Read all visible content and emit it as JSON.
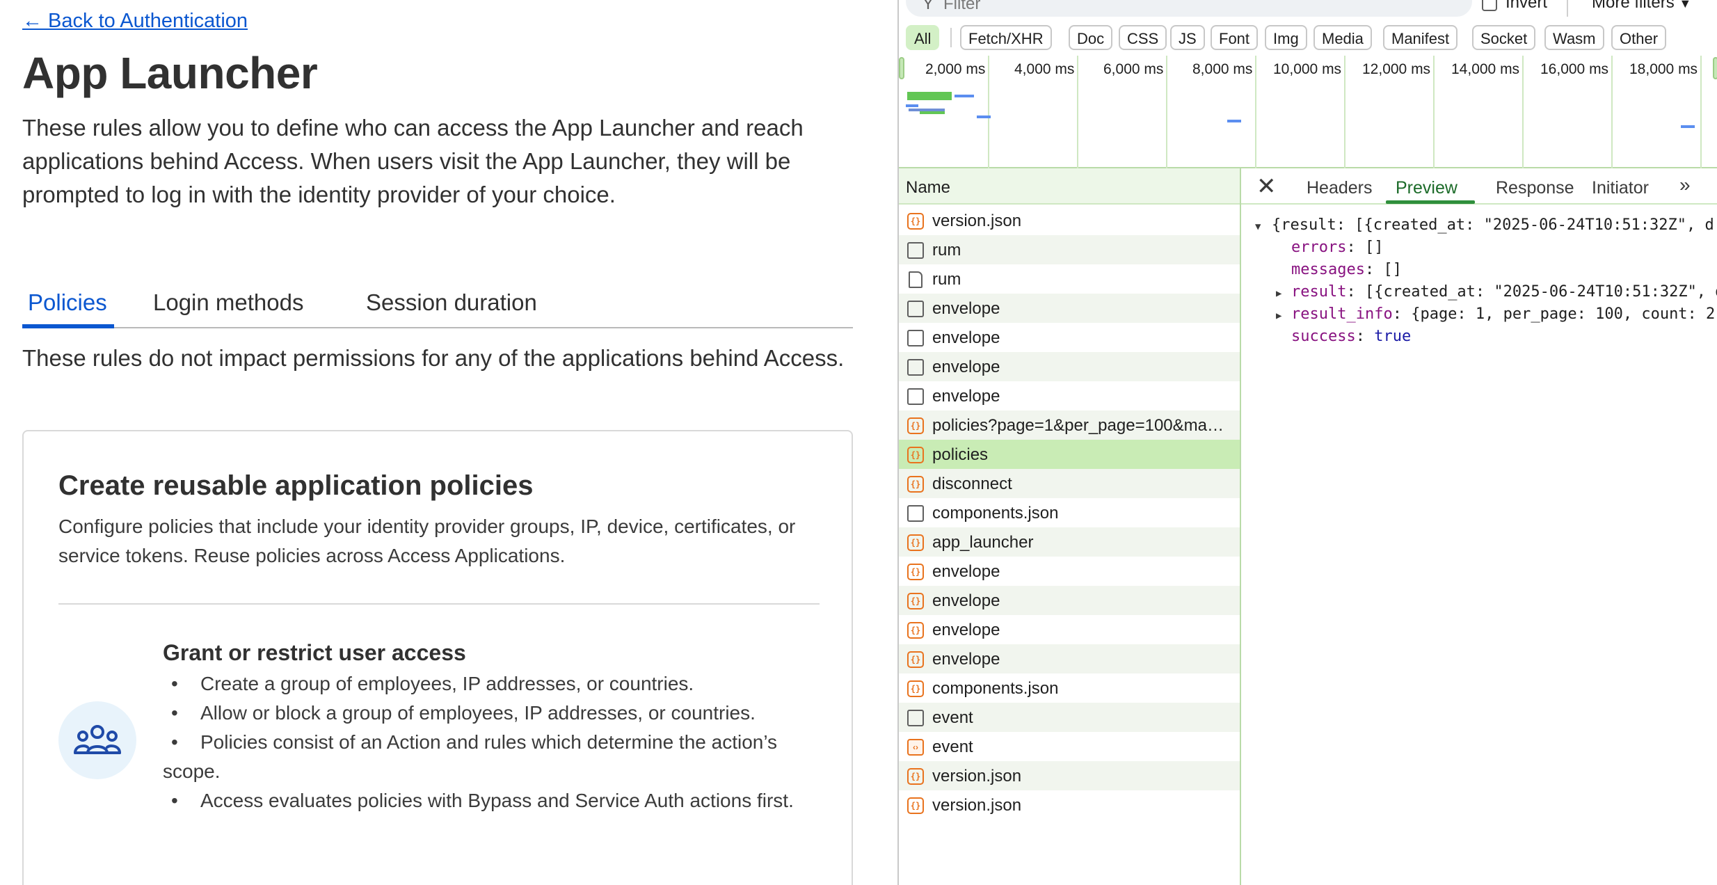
{
  "app": {
    "back_link": "← Back to Authentication",
    "title": "App Launcher",
    "description": "These rules allow you to define who can access the App Launcher and reach applications behind Access. When users visit the App Launcher, they will be prompted to log in with the identity provider of your choice.",
    "tabs": [
      {
        "label": "Policies",
        "active": true
      },
      {
        "label": "Login methods",
        "active": false
      },
      {
        "label": "Session duration",
        "active": false
      }
    ],
    "tab_note": "These rules do not impact permissions for any of the applications behind Access.",
    "card": {
      "title": "Create reusable application policies",
      "description": "Configure policies that include your identity provider groups, IP, device, certificates, or service tokens. Reuse policies across Access Applications.",
      "icon": "users-group-icon",
      "section_title": "Grant or restrict user access",
      "bullets": [
        "Create a group of employees, IP addresses, or countries.",
        "Allow or block a group of employees, IP addresses, or countries.",
        "Policies consist of an Action and rules which determine the action’s scope.",
        "Access evaluates policies with Bypass and Service Auth actions first."
      ]
    }
  },
  "devtools": {
    "filter_placeholder": "Filter",
    "invert_label": "Invert",
    "more_filters": "More filters",
    "type_filters": [
      "All",
      "Fetch/XHR",
      "Doc",
      "CSS",
      "JS",
      "Font",
      "Img",
      "Media",
      "Manifest",
      "Socket",
      "Wasm",
      "Other"
    ],
    "active_type_filter": "All",
    "timeline_ticks": [
      "2,000 ms",
      "4,000 ms",
      "6,000 ms",
      "8,000 ms",
      "10,000 ms",
      "12,000 ms",
      "14,000 ms",
      "16,000 ms",
      "18,000 ms"
    ],
    "name_header": "Name",
    "requests": [
      {
        "name": "version.json",
        "icon": "json-icon"
      },
      {
        "name": "rum",
        "icon": "checkbox-icon"
      },
      {
        "name": "rum",
        "icon": "document-icon"
      },
      {
        "name": "envelope",
        "icon": "checkbox-icon"
      },
      {
        "name": "envelope",
        "icon": "checkbox-icon"
      },
      {
        "name": "envelope",
        "icon": "checkbox-icon"
      },
      {
        "name": "envelope",
        "icon": "checkbox-icon"
      },
      {
        "name": "policies?page=1&per_page=100&ma…",
        "icon": "json-icon"
      },
      {
        "name": "policies",
        "icon": "json-icon",
        "selected": true
      },
      {
        "name": "disconnect",
        "icon": "json-icon"
      },
      {
        "name": "components.json",
        "icon": "checkbox-icon"
      },
      {
        "name": "app_launcher",
        "icon": "json-icon"
      },
      {
        "name": "envelope",
        "icon": "json-icon"
      },
      {
        "name": "envelope",
        "icon": "json-icon"
      },
      {
        "name": "envelope",
        "icon": "json-icon"
      },
      {
        "name": "envelope",
        "icon": "json-icon"
      },
      {
        "name": "components.json",
        "icon": "json-icon"
      },
      {
        "name": "event",
        "icon": "checkbox-icon"
      },
      {
        "name": "event",
        "icon": "event-icon"
      },
      {
        "name": "version.json",
        "icon": "json-icon"
      },
      {
        "name": "version.json",
        "icon": "json-icon"
      }
    ],
    "detail_tabs": [
      "Headers",
      "Preview",
      "Response",
      "Initiator"
    ],
    "active_detail_tab": "Preview",
    "more_tabs": "»",
    "preview": {
      "root": "{result: [{created_at: \"2025-06-24T10:51:32Z\", d",
      "errors_key": "errors",
      "errors_val": "[]",
      "messages_key": "messages",
      "messages_val": "[]",
      "result_key": "result",
      "result_val": "[{created_at: \"2025-06-24T10:51:32Z\", d",
      "result_info_key": "result_info",
      "result_info_val": "{page: 1, per_page: 100, count: 2,",
      "success_key": "success",
      "success_val": "true"
    }
  },
  "colors": {
    "accent_blue": "#0b57d0",
    "devtools_green": "#c9ecb5",
    "json_orange": "#e9731e"
  }
}
